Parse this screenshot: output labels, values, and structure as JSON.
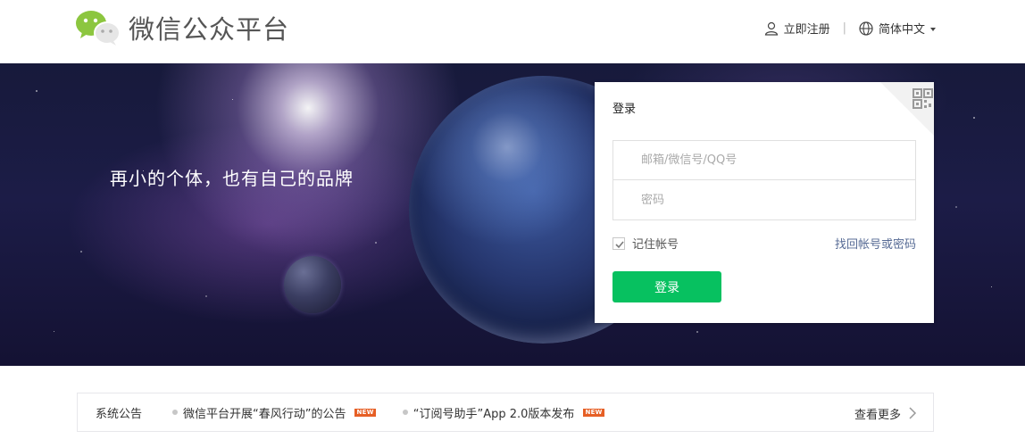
{
  "header": {
    "logo_text": "微信公众平台",
    "register_label": "立即注册",
    "separator": "|",
    "language_label": "简体中文"
  },
  "banner": {
    "slogan": "再小的个体，也有自己的品牌"
  },
  "login": {
    "title": "登录",
    "username_placeholder": "邮箱/微信号/QQ号",
    "password_placeholder": "密码",
    "remember_label": "记住帐号",
    "remember_checked": true,
    "forgot_label": "找回帐号或密码",
    "submit_label": "登录"
  },
  "notice": {
    "title": "系统公告",
    "items": [
      {
        "text": "微信平台开展“春风行动”的公告",
        "badge": "NEW"
      },
      {
        "text": "“订阅号助手”App 2.0版本发布",
        "badge": "NEW"
      }
    ],
    "more_label": "查看更多"
  },
  "colors": {
    "accent_green": "#07c160",
    "link_blue": "#576b95",
    "badge_orange": "#e65f25"
  },
  "icons": [
    "wechat-logo-icon",
    "user-icon",
    "globe-icon",
    "chevron-down-icon",
    "qrcode-icon",
    "check-icon",
    "chevron-right-icon"
  ]
}
